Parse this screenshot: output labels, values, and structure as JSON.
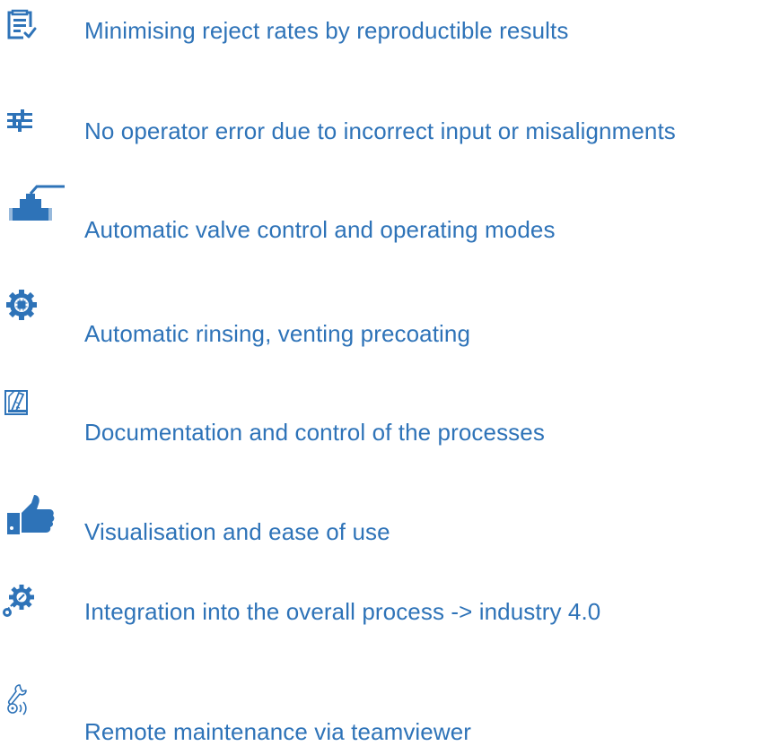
{
  "theme": {
    "icon_color": "#2e73b8",
    "text_color": "#2e73b8",
    "background": "#ffffff"
  },
  "features": [
    {
      "icon": "clipboard-checklist-icon",
      "label": "Minimising reject rates by reproductible results"
    },
    {
      "icon": "sliders-icon",
      "label": "No operator error due to incorrect input or misalignments"
    },
    {
      "icon": "valve-icon",
      "label": "Automatic valve control and operating modes"
    },
    {
      "icon": "gear-chip-icon",
      "label": "Automatic rinsing, venting precoating"
    },
    {
      "icon": "documentation-icon",
      "label": "Documentation and control of the processes"
    },
    {
      "icon": "thumbs-up-icon",
      "label": "Visualisation and ease of use"
    },
    {
      "icon": "gear-network-icon",
      "label": "Integration into the overall process -> industry 4.0"
    },
    {
      "icon": "remote-wrench-icon",
      "label": "Remote maintenance via teamviewer"
    }
  ]
}
